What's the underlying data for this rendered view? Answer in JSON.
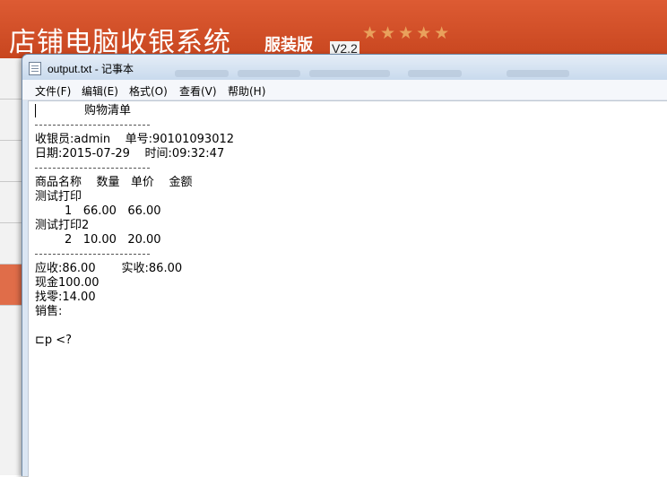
{
  "pos_app": {
    "title": "店铺电脑收银系统",
    "edition": "服装版",
    "version": "V2.2",
    "stars": "★★★★★"
  },
  "notepad": {
    "window_title": "output.txt - 记事本",
    "menu": {
      "file": "文件(F)",
      "edit": "编辑(E)",
      "format": "格式(O)",
      "view": "查看(V)",
      "help": "帮助(H)"
    },
    "receipt": {
      "heading": "购物清单",
      "cashier_line": "收银员:admin    单号:90101093012",
      "date_line": "日期:2015-07-29    时间:09:32:47",
      "columns_line": "商品名称    数量   单价    金额",
      "item1_name": "测试打印",
      "item1_detail": "        1   66.00   66.00",
      "item2_name": "测试打印2",
      "item2_detail": "        2   10.00   20.00",
      "receivable_line": "应收:86.00       实收:86.00",
      "cash_line": "现金100.00",
      "change_line": "找零:14.00",
      "sales_line": "销售:",
      "garbled_line": "⊏p <?"
    }
  },
  "colors": {
    "pos_header": "#d5522e",
    "notepad_frame": "#dbe6f3"
  }
}
